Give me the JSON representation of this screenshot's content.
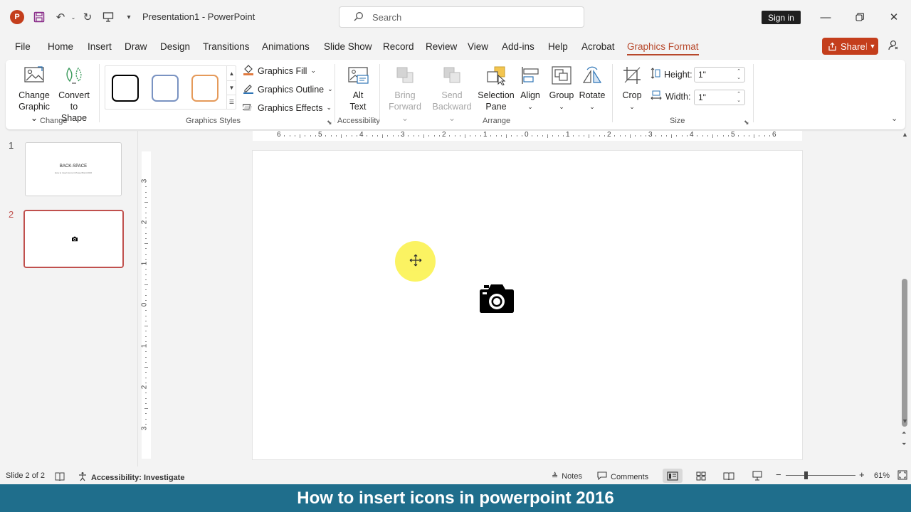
{
  "titlebar": {
    "app_icon": "P",
    "title": "Presentation1  -  PowerPoint",
    "search_placeholder": "Search",
    "signin": "Sign in"
  },
  "tabs": [
    "File",
    "Home",
    "Insert",
    "Draw",
    "Design",
    "Transitions",
    "Animations",
    "Slide Show",
    "Record",
    "Review",
    "View",
    "Add-ins",
    "Help",
    "Acrobat",
    "Graphics Format"
  ],
  "active_tab": "Graphics Format",
  "share_label": "Share",
  "ribbon": {
    "change": {
      "change_graphic_1": "Change",
      "change_graphic_2": "Graphic",
      "convert_1": "Convert",
      "convert_2": "to Shape",
      "label": "Change"
    },
    "styles": {
      "fill": "Graphics Fill",
      "outline": "Graphics Outline",
      "effects": "Graphics Effects",
      "label": "Graphics Styles",
      "swatch_colors": [
        "#000000",
        "#7a93c2",
        "#e59a5a"
      ]
    },
    "accessibility": {
      "alt_1": "Alt",
      "alt_2": "Text",
      "label": "Accessibility"
    },
    "arrange": {
      "bring_1": "Bring",
      "bring_2": "Forward",
      "send_1": "Send",
      "send_2": "Backward",
      "selection_1": "Selection",
      "selection_2": "Pane",
      "align": "Align",
      "group": "Group",
      "rotate": "Rotate",
      "label": "Arrange"
    },
    "size": {
      "crop": "Crop",
      "height_label": "Height:",
      "height_value": "1\"",
      "width_label": "Width:",
      "width_value": "1\"",
      "label": "Size"
    }
  },
  "slides": [
    {
      "number": "1",
      "title": "BACK-SPACE",
      "subtitle": "How to insert icons in PowerPoint 2016"
    },
    {
      "number": "2"
    }
  ],
  "ruler": {
    "h_labels": [
      "6",
      "5",
      "4",
      "3",
      "2",
      "1",
      "0",
      "1",
      "2",
      "3",
      "4",
      "5",
      "6"
    ],
    "v_labels": [
      "3",
      "2",
      "1",
      "0",
      "1",
      "2",
      "3"
    ]
  },
  "status": {
    "slide_info": "Slide 2 of 2",
    "accessibility": "Accessibility: Investigate",
    "notes": "Notes",
    "comments": "Comments",
    "zoom": "61%"
  },
  "caption": "How to insert icons in powerpoint 2016",
  "colors": {
    "accent": "#b7472a",
    "share": "#c43e1c",
    "caption_bg": "#1f6e8c",
    "highlight": "#fbf35a"
  }
}
